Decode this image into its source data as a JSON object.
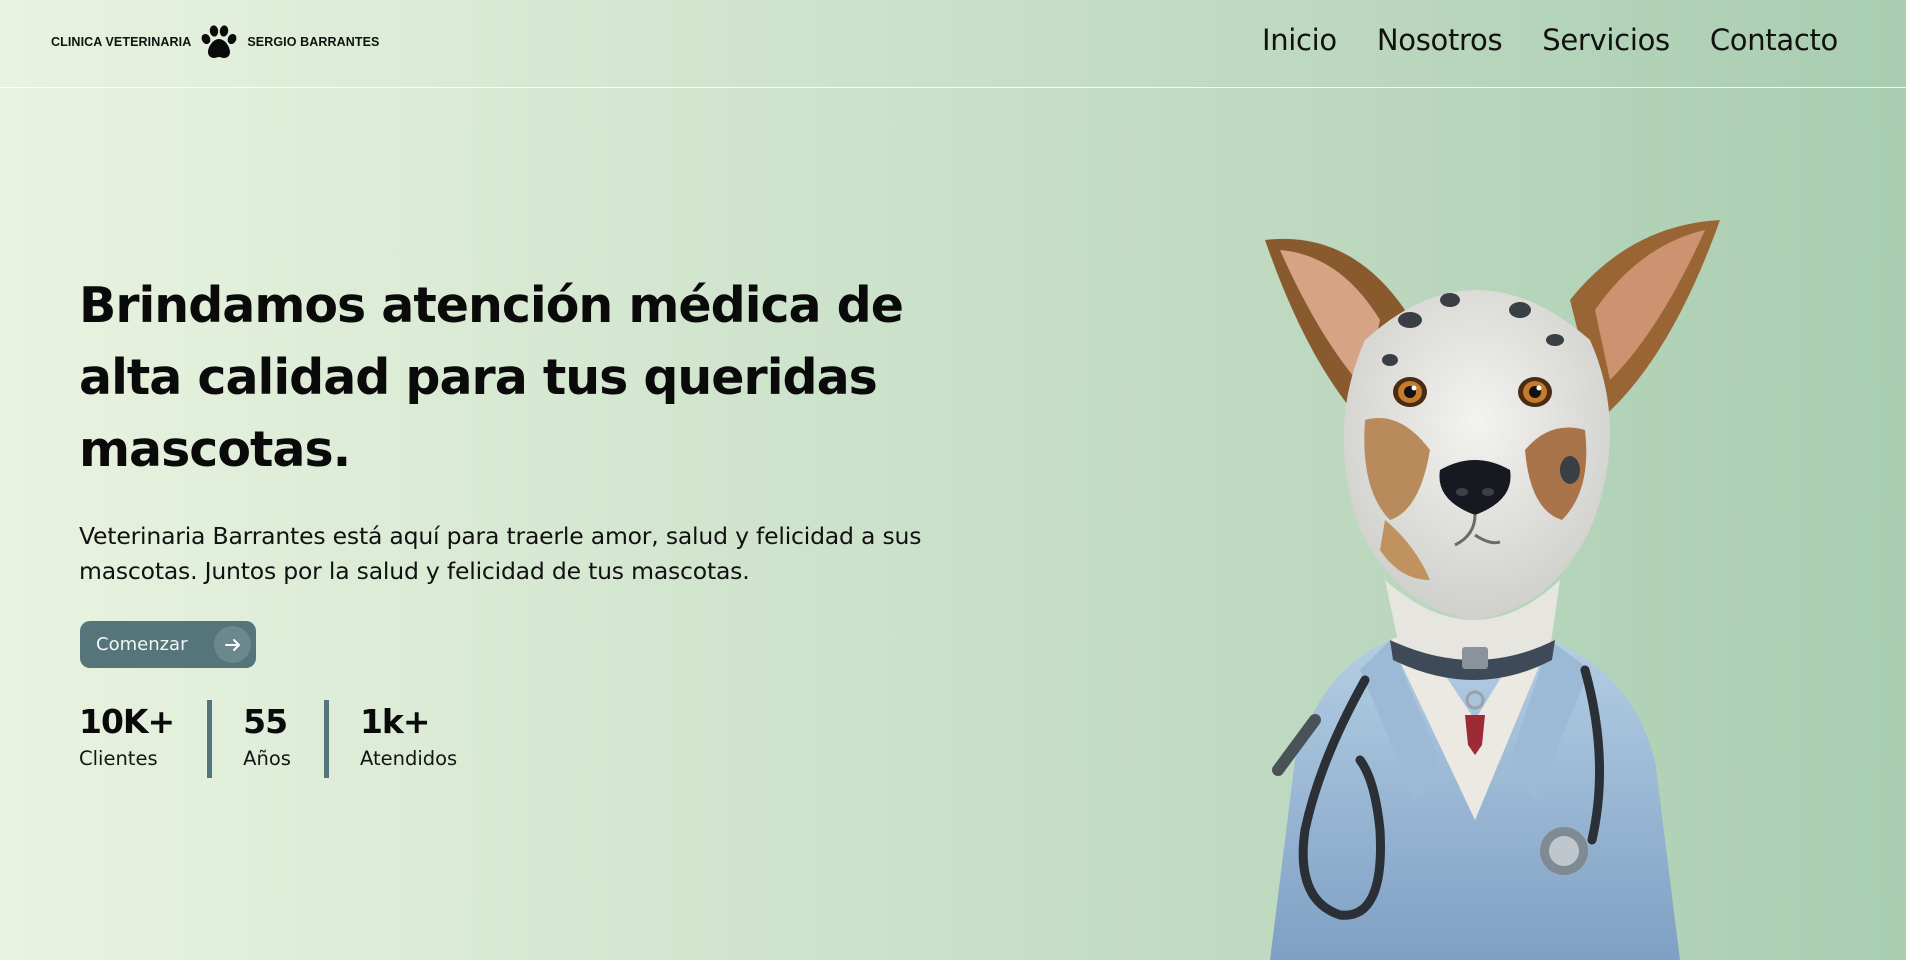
{
  "header": {
    "logo": {
      "text_left": "CLINICA VETERINARIA",
      "text_right": "SERGIO BARRANTES",
      "icon": "paw-icon"
    },
    "nav": [
      {
        "label": "Inicio"
      },
      {
        "label": "Nosotros"
      },
      {
        "label": "Servicios"
      },
      {
        "label": "Contacto"
      }
    ]
  },
  "hero": {
    "title_lines": [
      "Brindamos atención médica de",
      "alta calidad para tus queridas",
      "mascotas."
    ],
    "description_lines": [
      "Veterinaria Barrantes está aquí para traerle amor, salud y felicidad a sus",
      "mascotas. Juntos por la salud y felicidad de tus mascotas."
    ],
    "cta": {
      "label": "Comenzar",
      "icon": "arrow-right-icon"
    },
    "stats": [
      {
        "value": "10K+",
        "label": "Clientes"
      },
      {
        "value": "55",
        "label": "Años"
      },
      {
        "value": "1k+",
        "label": "Atendidos"
      }
    ],
    "image": {
      "subject": "dog-doctor-illustration"
    }
  },
  "colors": {
    "accent": "#56757b",
    "background_start": "#e9f3e0",
    "background_end": "#a9cdb0"
  }
}
